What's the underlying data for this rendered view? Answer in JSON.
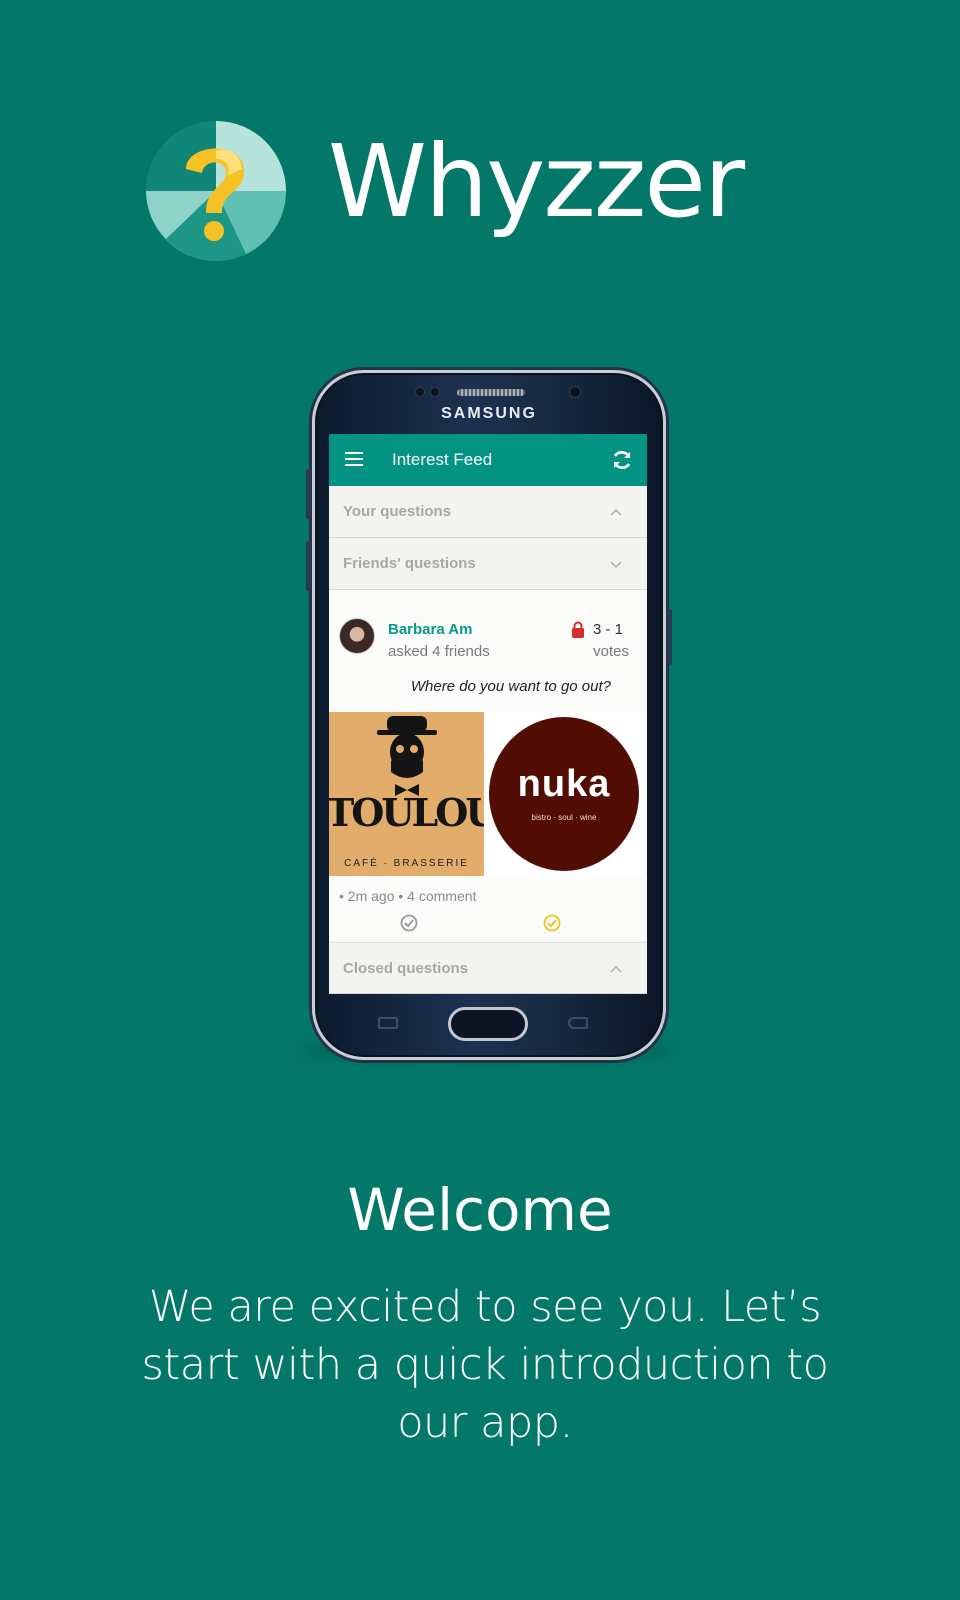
{
  "brand": {
    "app_name": "Whyzzer",
    "logo_icon": "question-mark-logo-icon",
    "colors": {
      "background": "#037868",
      "appbar": "#039383",
      "accent_yellow": "#f6c125",
      "lock_red": "#d32f2f"
    }
  },
  "device": {
    "brand": "SAMSUNG"
  },
  "app_screen": {
    "appbar": {
      "title": "Interest Feed",
      "menu_icon": "hamburger-menu-icon",
      "refresh_icon": "refresh-icon"
    },
    "sections": {
      "your_questions": "Your questions",
      "friends_questions": "Friends' questions",
      "closed_questions": "Closed questions"
    },
    "question_card": {
      "author": "Barbara Am",
      "subtitle": "asked 4 friends",
      "score": "3 - 1",
      "score_label": "votes",
      "question": "Where do you want to go out?",
      "option_left": {
        "word": "TOULOUSE",
        "sub": "CAFÉ · BRASSERIE"
      },
      "option_right": {
        "word": "nuka",
        "sub": "bistro · soul · wine"
      },
      "meta": "• 2m ago • 4 comment"
    }
  },
  "welcome": {
    "heading": "Welcome",
    "body": "We are excited to see you. Let’s start with a quick introduction to our app."
  }
}
